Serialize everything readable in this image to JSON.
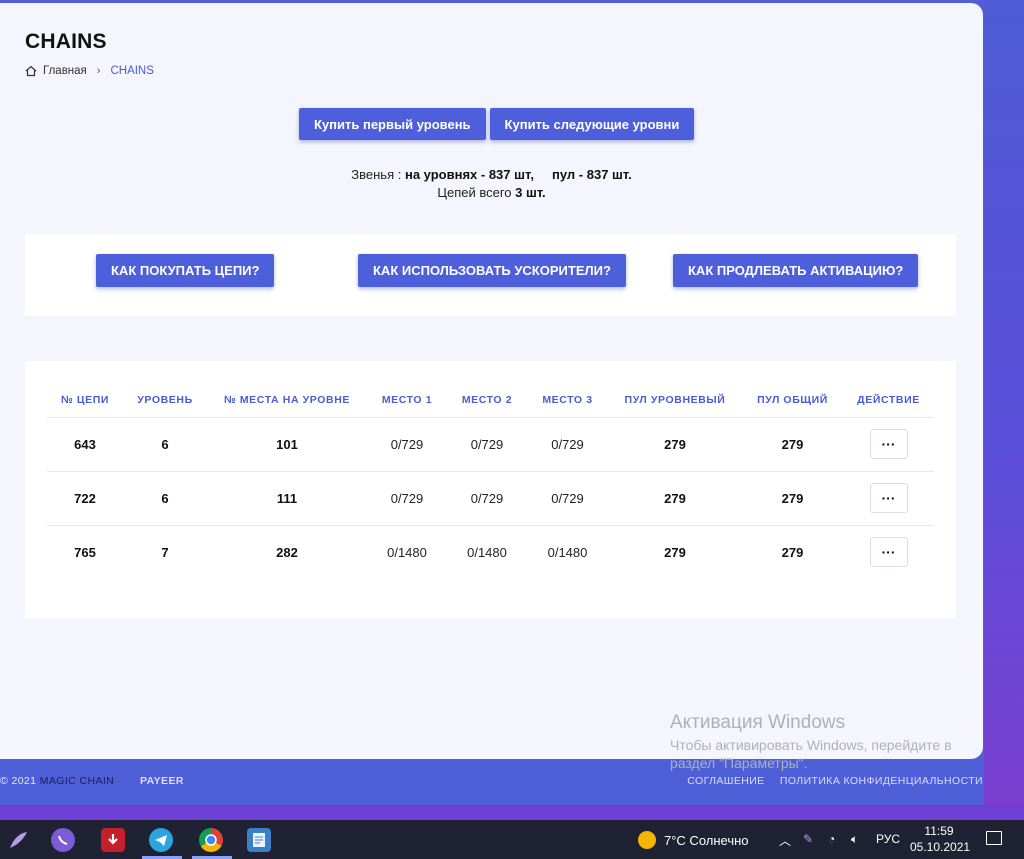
{
  "page": {
    "title": "CHAINS",
    "breadcrumb": {
      "home": "Главная",
      "current": "CHAINS"
    }
  },
  "buy": {
    "first_level": "Купить первый уровень",
    "next_levels": "Купить следующие уровни"
  },
  "stats": {
    "links_label": "Звенья :",
    "links_levels": "на уровнях - 837 шт,",
    "links_pool": "пул - 837 шт.",
    "chains_label": "Цепей всего",
    "chains_total": "3 шт."
  },
  "help": {
    "how_buy": "КАК ПОКУПАТЬ ЦЕПИ?",
    "how_boost": "КАК ИСПОЛЬЗОВАТЬ УСКОРИТЕЛИ?",
    "how_extend": "КАК ПРОДЛЕВАТЬ АКТИВАЦИЮ?"
  },
  "table": {
    "headers": [
      "№ ЦЕПИ",
      "УРОВЕНЬ",
      "№ МЕСТА НА УРОВНЕ",
      "МЕСТО 1",
      "МЕСТО 2",
      "МЕСТО 3",
      "ПУЛ УРОВНЕВЫЙ",
      "ПУЛ ОБЩИЙ",
      "ДЕЙСТВИЕ"
    ],
    "rows": [
      {
        "chain": "643",
        "level": "6",
        "place": "101",
        "p1": "0/729",
        "p2": "0/729",
        "p3": "0/729",
        "pool_level": "279",
        "pool_total": "279",
        "action": "···"
      },
      {
        "chain": "722",
        "level": "6",
        "place": "111",
        "p1": "0/729",
        "p2": "0/729",
        "p3": "0/729",
        "pool_level": "279",
        "pool_total": "279",
        "action": "···"
      },
      {
        "chain": "765",
        "level": "7",
        "place": "282",
        "p1": "0/1480",
        "p2": "0/1480",
        "p3": "0/1480",
        "pool_level": "279",
        "pool_total": "279",
        "action": "···"
      }
    ]
  },
  "watermark": {
    "title": "Активация Windows",
    "line1": "Чтобы активировать Windows, перейдите в",
    "line2": "раздел \"Параметры\"."
  },
  "footer": {
    "copyright": "© 2021",
    "brand": "MAGIC CHAIN",
    "payeer": "PAYEER",
    "agreement": "СОГЛАШЕНИЕ",
    "privacy": "ПОЛИТИКА КОНФИДЕНЦИАЛЬНОСТИ"
  },
  "taskbar": {
    "weather": "7°C  Солнечно",
    "lang": "РУС",
    "time": "11:59",
    "date": "05.10.2021"
  },
  "colors": {
    "accent": "#4e5fdc",
    "frame": "#4f5fd8",
    "card": "#f4f5fd"
  }
}
